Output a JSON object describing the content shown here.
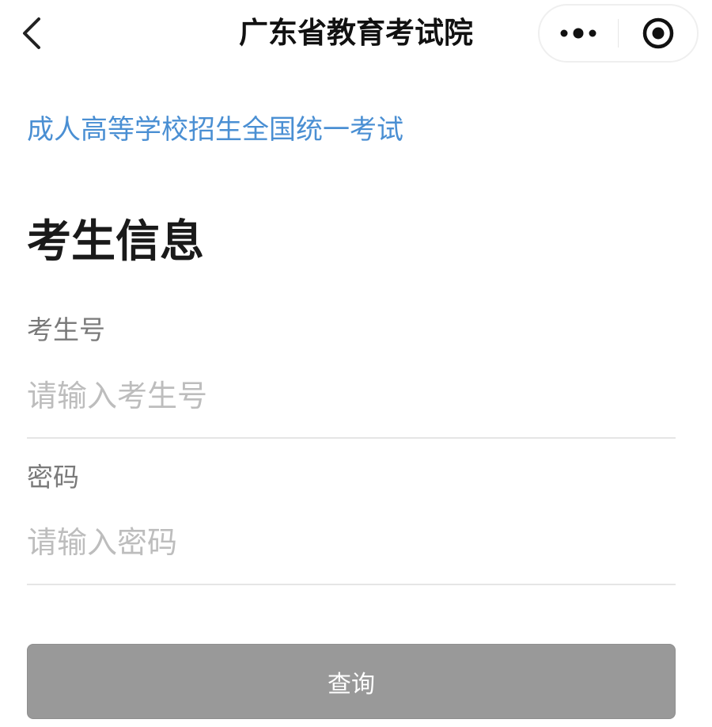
{
  "navbar": {
    "title": "广东省教育考试院",
    "back_icon": "chevron-left-icon",
    "more_icon": "more-dots-icon",
    "close_icon": "target-circle-icon"
  },
  "content": {
    "exam_name": "成人高等学校招生全国统一考试",
    "section_title": "考生信息",
    "fields": [
      {
        "label": "考生号",
        "placeholder": "请输入考生号",
        "value": ""
      },
      {
        "label": "密码",
        "placeholder": "请输入密码",
        "value": ""
      }
    ],
    "submit_label": "查询"
  },
  "colors": {
    "link_blue": "#4a8fd3",
    "button_disabled": "#999999",
    "placeholder": "#bdbdbd",
    "label_gray": "#7a7a7a"
  }
}
